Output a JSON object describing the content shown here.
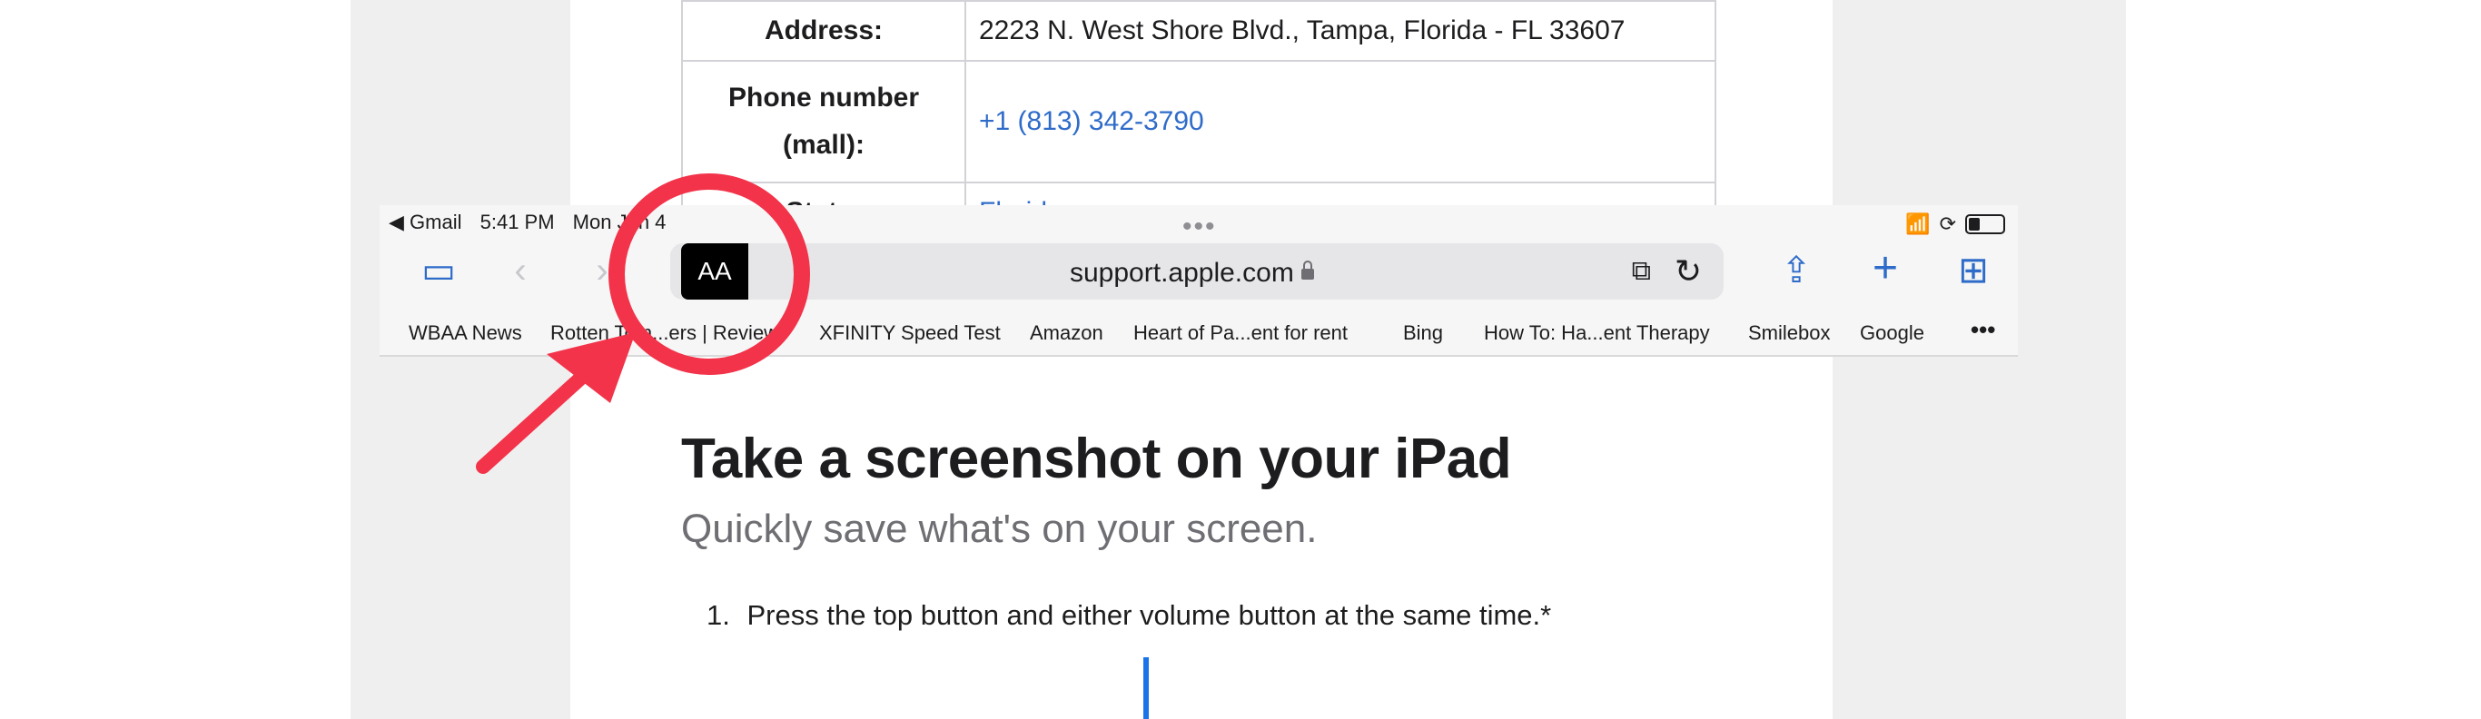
{
  "table": {
    "rows": [
      {
        "key": "Address:",
        "value": "2223 N. West Shore Blvd., Tampa, Florida - FL 33607",
        "is_link": false
      },
      {
        "key": "Phone number (mall):",
        "value": "+1 (813) 342-3790",
        "is_link": true
      },
      {
        "key": "State:",
        "value": "Florida",
        "is_link": true
      }
    ]
  },
  "status_bar": {
    "back_app": "◀ Gmail",
    "time": "5:41 PM",
    "date": "Mon Jun 4"
  },
  "toolbar": {
    "text_size_label": "AA",
    "url": "support.apple.com"
  },
  "bookmarks": [
    "WBAA News",
    "Rotten Tom...ers | Reviews",
    "XFINITY Speed Test",
    "Amazon",
    "Heart of Pa...ent for rent",
    "Bing",
    "How To: Ha...ent Therapy",
    "Smilebox",
    "Google"
  ],
  "article": {
    "title": "Take a screenshot on your iPad",
    "subtitle": "Quickly save what's on your screen.",
    "step_number": "1.",
    "step_text": "Press the top button and either volume button at the same time.*"
  },
  "colors": {
    "link": "#2f6cc9",
    "annotation": "#f2334a",
    "highlight_bar": "#1a73e8"
  }
}
